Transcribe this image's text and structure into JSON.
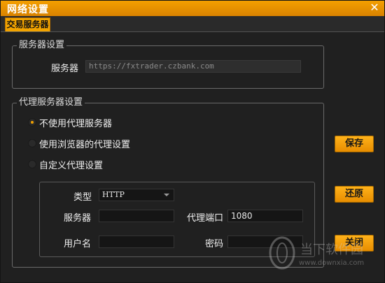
{
  "window": {
    "title": "网络设置",
    "close_glyph": "✕"
  },
  "tabs": [
    {
      "label": "交易服务器",
      "active": true
    }
  ],
  "server_group": {
    "legend": "服务器设置",
    "server_label": "服务器",
    "server_value": "https://fxtrader.czbank.com"
  },
  "proxy_group": {
    "legend": "代理服务器设置",
    "options": [
      {
        "label": "不使用代理服务器",
        "checked": true
      },
      {
        "label": "使用浏览器的代理设置",
        "checked": false
      },
      {
        "label": "自定义代理设置",
        "checked": false
      }
    ],
    "custom": {
      "type_label": "类型",
      "type_value": "HTTP",
      "server_label": "服务器",
      "server_value": "",
      "port_label": "代理端口",
      "port_value": "1080",
      "user_label": "用户名",
      "user_value": "",
      "password_label": "密码",
      "password_value": ""
    }
  },
  "buttons": {
    "save": "保存",
    "restore": "还原",
    "close": "关闭"
  },
  "watermark": {
    "brand": "当下软件园",
    "url": "www.downxia.com"
  },
  "colors": {
    "accent": "#f0a000",
    "background": "#202020"
  }
}
